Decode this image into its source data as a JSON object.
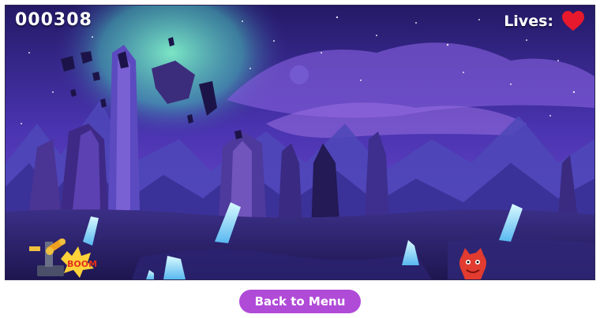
{
  "hud": {
    "score": "000308",
    "lives_label": "Lives:",
    "lives_count": 1,
    "heart_color": "#e8192c"
  },
  "scene": {
    "cannon_effect_text": "BOOM",
    "enemy_color": "#e23b30",
    "palette": {
      "sky_top": "#2a1f6e",
      "sky_mid": "#5b3fc0",
      "aurora": "#5fe0b8",
      "ground": "#2b2a6b",
      "crystal": "#8fe6ff"
    }
  },
  "footer": {
    "back_button_label": "Back to Menu",
    "button_color": "#b04bd8"
  }
}
